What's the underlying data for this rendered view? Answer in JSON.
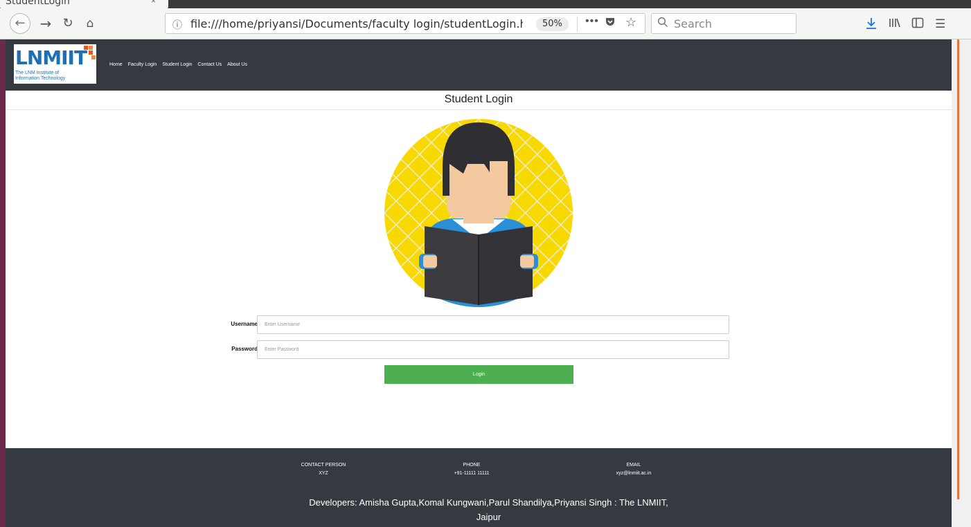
{
  "browser": {
    "tab_title": "StudentLogin",
    "tab_close": "×",
    "url": "file:///home/priyansi/Documents/faculty login/studentLogin.ht",
    "zoom": "50%",
    "more_icon": "•••",
    "search_placeholder": "Search"
  },
  "site": {
    "logo": {
      "name": "LNMIIT",
      "line1": "The LNM Institute of",
      "line2": "Information Technology"
    },
    "nav": [
      "Home",
      "Faculty Login",
      "Student Login",
      "Contact Us",
      "About Us"
    ],
    "page_title": "Student Login"
  },
  "form": {
    "username_label": "Username",
    "username_placeholder": "Enter Username",
    "password_label": "Password",
    "password_placeholder": "Enter Password",
    "login_label": "Login",
    "button_color": "#4caf50"
  },
  "footer": {
    "contact_heading": "CONTACT PERSON",
    "contact_value": "XYZ",
    "phone_heading": "PHONE",
    "phone_value": "+91-11111 11111",
    "email_heading": "EMAIL",
    "email_value": "xyz@lnmiit.ac.in",
    "developers_line1": "Developers: Amisha Gupta,Komal Kungwani,Parul Shandilya,Priyansi Singh : The LNMIIT,",
    "developers_line2": "Jaipur"
  },
  "colors": {
    "header_bg": "#343a40",
    "avatar_circle": "#f5d800",
    "accent": "#e8743a"
  }
}
